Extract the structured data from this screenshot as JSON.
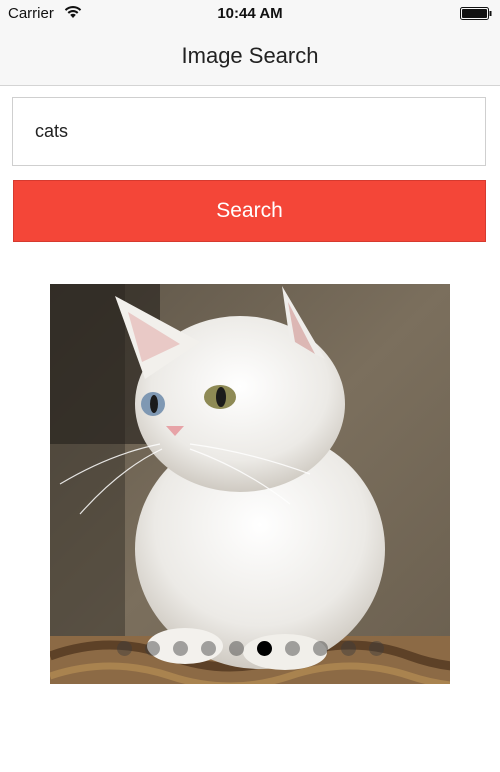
{
  "status_bar": {
    "carrier": "Carrier",
    "time": "10:44 AM",
    "wifi_icon": "wifi-icon",
    "battery_icon": "battery-icon"
  },
  "nav": {
    "title": "Image Search"
  },
  "search": {
    "value": "cats",
    "button_label": "Search"
  },
  "carousel": {
    "image_subject": "white kitten",
    "page_count": 10,
    "current_page": 6,
    "active_dot_color": "#000000"
  },
  "colors": {
    "accent": "#f44638",
    "nav_background": "#f7f7f7"
  }
}
